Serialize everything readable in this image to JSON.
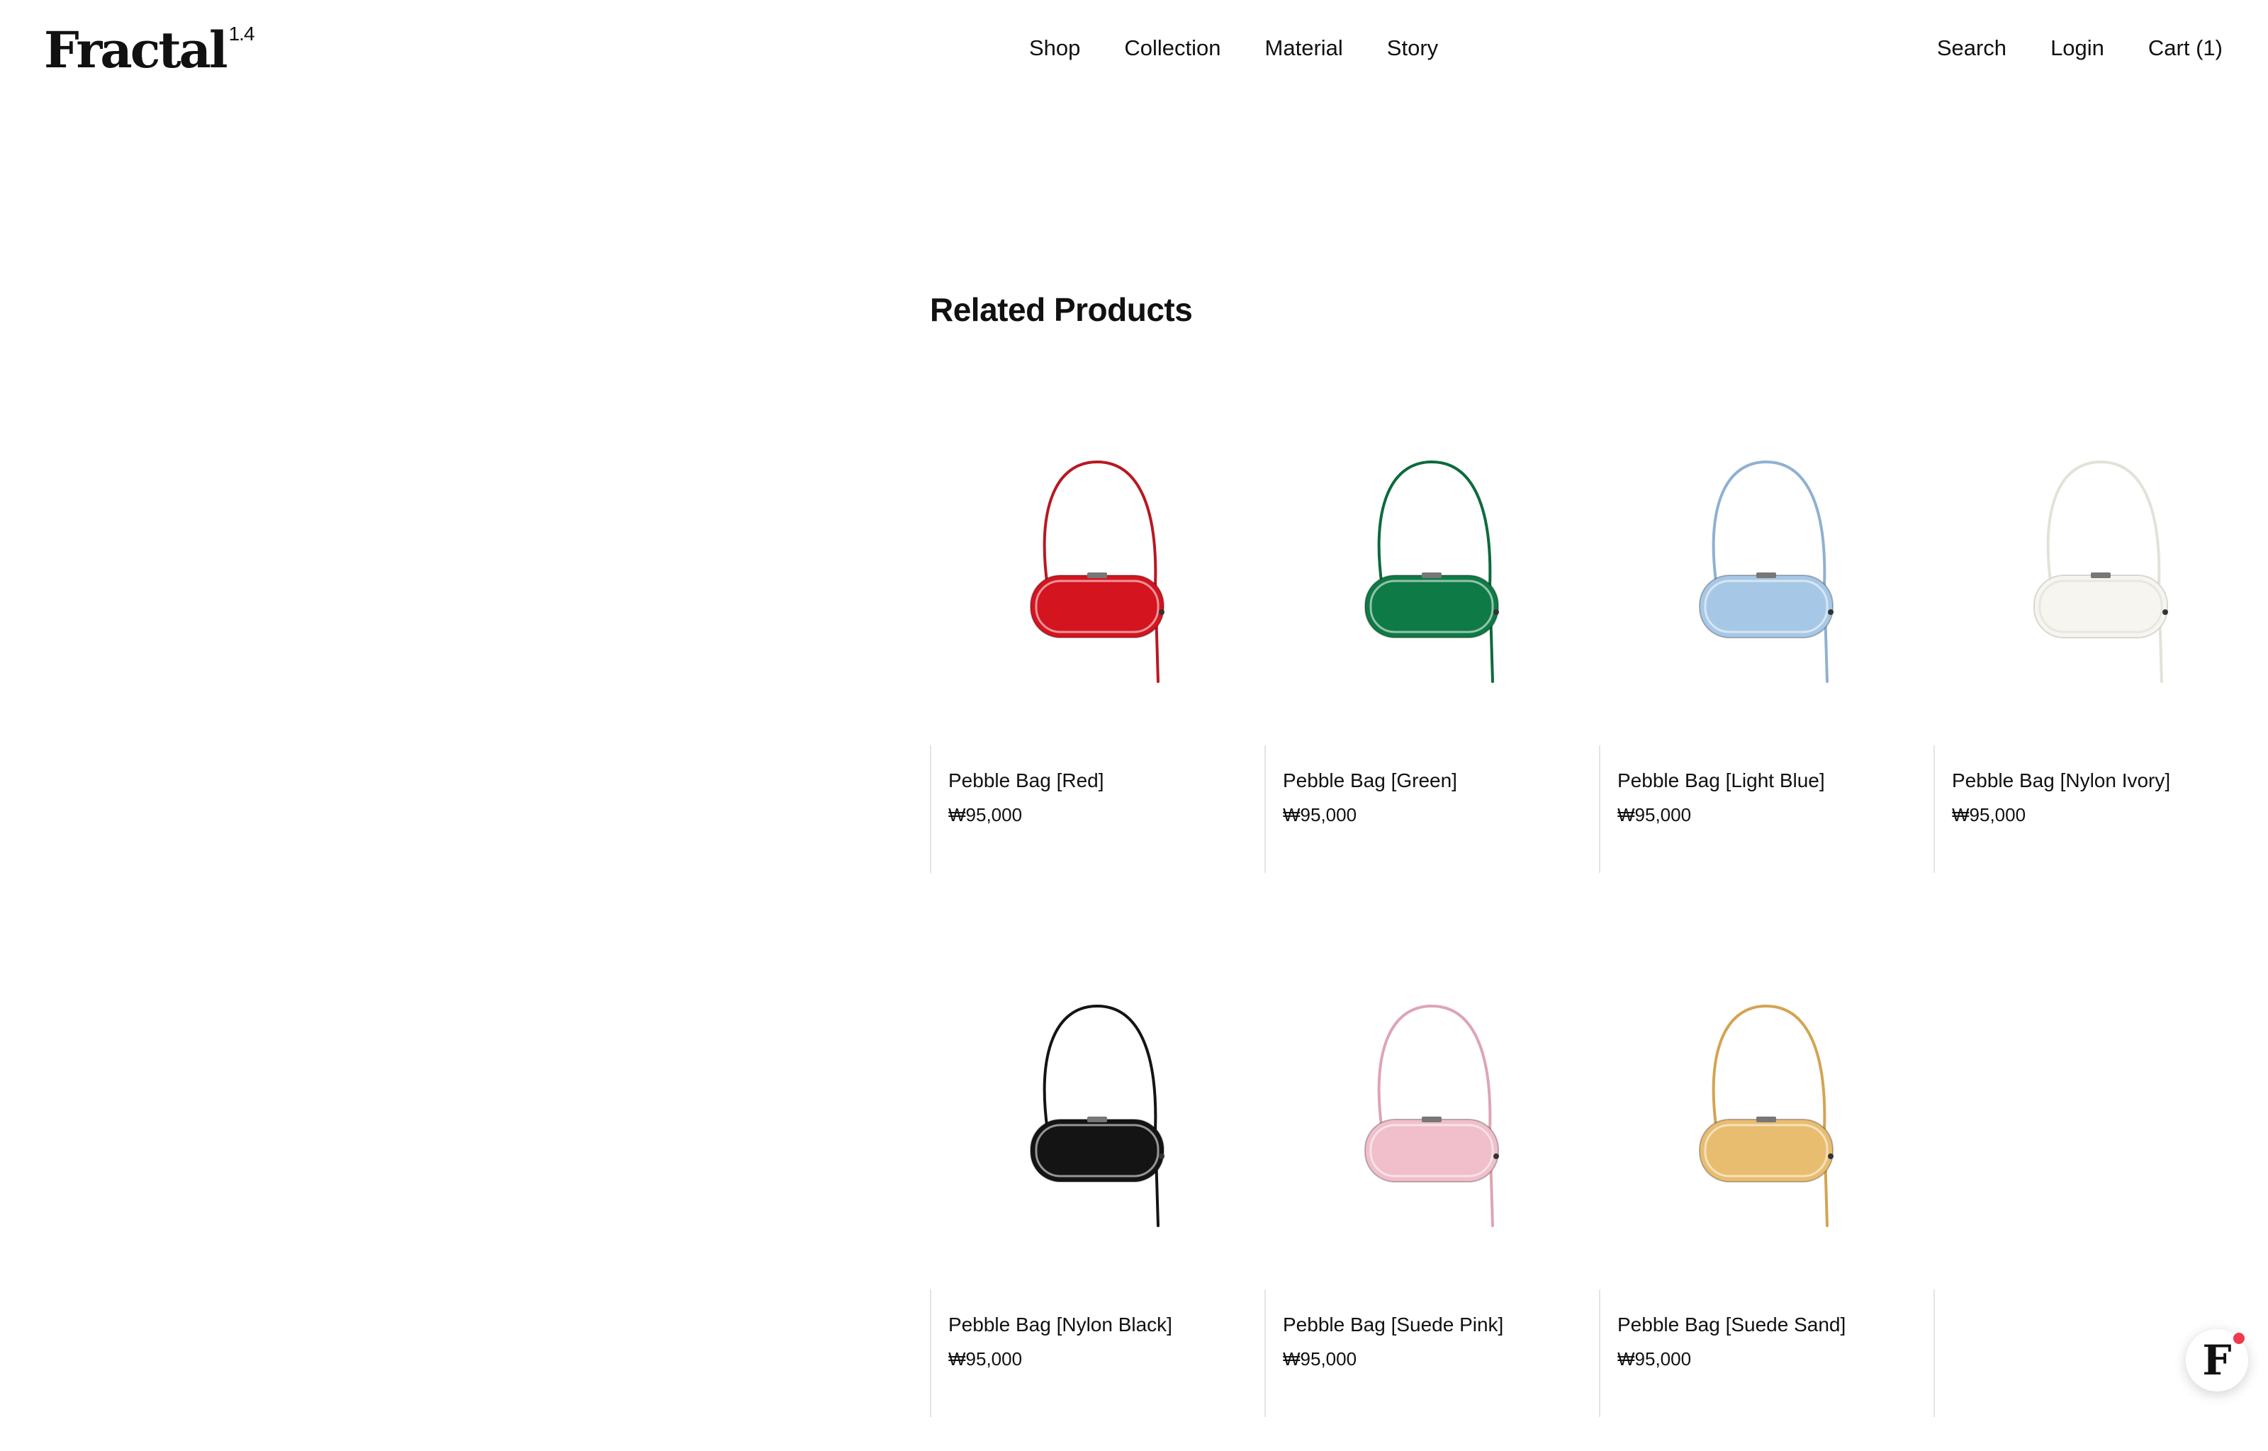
{
  "header": {
    "logo_text": "Fractal",
    "logo_version": "1.4",
    "main_nav": [
      "Shop",
      "Collection",
      "Material",
      "Story"
    ],
    "util_nav": [
      "Search",
      "Login",
      "Cart (1)"
    ]
  },
  "section": {
    "title": "Related Products"
  },
  "products": [
    {
      "name": "Pebble Bag [Red]",
      "price": "₩95,000",
      "color": "#d4141f",
      "strap": "#b81822",
      "light": false
    },
    {
      "name": "Pebble Bag [Green]",
      "price": "₩95,000",
      "color": "#0e7a45",
      "strap": "#0d6a3c",
      "light": false
    },
    {
      "name": "Pebble Bag [Light Blue]",
      "price": "₩95,000",
      "color": "#a6c8e6",
      "strap": "#8fb1d1",
      "light": false
    },
    {
      "name": "Pebble Bag [Nylon Ivory]",
      "price": "₩95,000",
      "color": "#f6f5f0",
      "strap": "#e3e2d8",
      "light": true
    },
    {
      "name": "Pebble Bag [Nylon Black]",
      "price": "₩95,000",
      "color": "#141414",
      "strap": "#141414",
      "light": false
    },
    {
      "name": "Pebble Bag [Suede Pink]",
      "price": "₩95,000",
      "color": "#f0bfcb",
      "strap": "#dea5b4",
      "light": false
    },
    {
      "name": "Pebble Bag [Suede Sand]",
      "price": "₩95,000",
      "color": "#e8bd70",
      "strap": "#d3a452",
      "light": false
    }
  ],
  "chat_widget": {
    "letter": "F",
    "badge_color": "#f03a4b"
  }
}
